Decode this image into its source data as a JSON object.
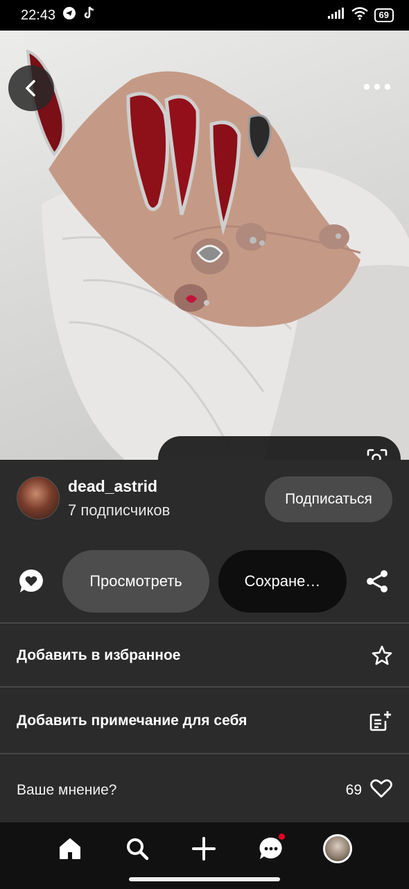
{
  "status_bar": {
    "time": "22:43",
    "battery": "69"
  },
  "author": {
    "name": "dead_astrid",
    "subscribers": "7 подписчиков",
    "subscribe_label": "Подписаться"
  },
  "actions": {
    "view_label": "Просмотреть",
    "save_label": "Сохране…"
  },
  "menu": {
    "favorite_label": "Добавить в избранное",
    "note_label": "Добавить примечание для себя"
  },
  "opinion": {
    "label": "Ваше мнение?",
    "likes": "69"
  },
  "colors": {
    "accent": "#e60023",
    "panel": "#2b2b2b",
    "pill": "#4d4d4d"
  }
}
